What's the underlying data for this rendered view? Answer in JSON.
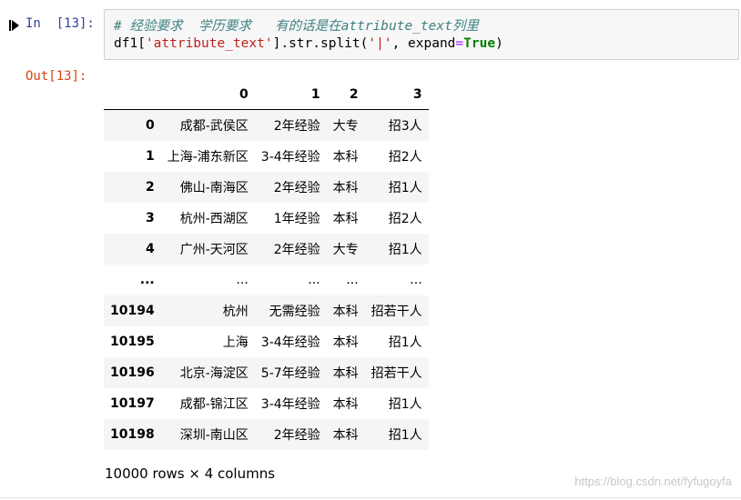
{
  "input_cell": {
    "prompt_in": "In",
    "prompt_num": "[13]:",
    "code_comment": "# 经验要求  学历要求   有的话是在attribute_text列里",
    "code_line2_pre": "df1[",
    "code_line2_str1": "'attribute_text'",
    "code_line2_mid": "].str.split(",
    "code_line2_str2": "'|'",
    "code_line2_mid2": ", expand",
    "code_line2_eq": "=",
    "code_line2_kw": "True",
    "code_line2_post": ")"
  },
  "output_cell": {
    "prompt": "Out[13]:",
    "table": {
      "columns": [
        "",
        "0",
        "1",
        "2",
        "3"
      ],
      "rows": [
        {
          "index": "0",
          "cells": [
            "成都-武侯区",
            "2年经验",
            "大专",
            "招3人"
          ]
        },
        {
          "index": "1",
          "cells": [
            "上海-浦东新区",
            "3-4年经验",
            "本科",
            "招2人"
          ]
        },
        {
          "index": "2",
          "cells": [
            "佛山-南海区",
            "2年经验",
            "本科",
            "招1人"
          ]
        },
        {
          "index": "3",
          "cells": [
            "杭州-西湖区",
            "1年经验",
            "本科",
            "招2人"
          ]
        },
        {
          "index": "4",
          "cells": [
            "广州-天河区",
            "2年经验",
            "大专",
            "招1人"
          ]
        },
        {
          "index": "...",
          "cells": [
            "...",
            "...",
            "...",
            "..."
          ]
        },
        {
          "index": "10194",
          "cells": [
            "杭州",
            "无需经验",
            "本科",
            "招若干人"
          ]
        },
        {
          "index": "10195",
          "cells": [
            "上海",
            "3-4年经验",
            "本科",
            "招1人"
          ]
        },
        {
          "index": "10196",
          "cells": [
            "北京-海淀区",
            "5-7年经验",
            "本科",
            "招若干人"
          ]
        },
        {
          "index": "10197",
          "cells": [
            "成都-锦江区",
            "3-4年经验",
            "本科",
            "招1人"
          ]
        },
        {
          "index": "10198",
          "cells": [
            "深圳-南山区",
            "2年经验",
            "本科",
            "招1人"
          ]
        }
      ]
    },
    "dimensions": "10000 rows × 4 columns"
  },
  "watermark": "https://blog.csdn.net/fyfugoyfa",
  "colors": {
    "prompt_in": "#303f9f",
    "prompt_out": "#d84315",
    "comment": "#408080",
    "string": "#ba2121",
    "keyword": "#008000",
    "stripe": "#f5f5f5"
  },
  "icons": {
    "run": "run-cell-icon"
  }
}
